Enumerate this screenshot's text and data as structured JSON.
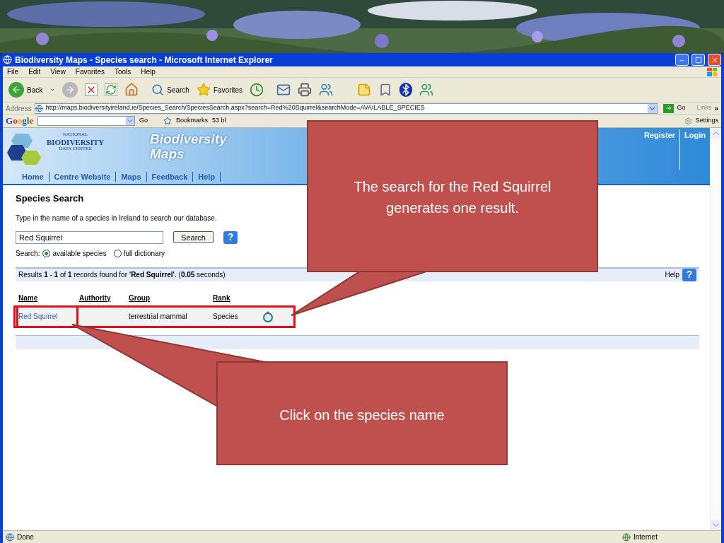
{
  "window": {
    "title": "Biodiversity Maps - Species search - Microsoft Internet Explorer"
  },
  "menu": [
    "File",
    "Edit",
    "View",
    "Favorites",
    "Tools",
    "Help"
  ],
  "toolbar": {
    "back": "Back",
    "search": "Search",
    "favorites": "Favorites"
  },
  "address": {
    "label": "Address",
    "url": "http://maps.biodiversityireland.ie/Species_Search/SpeciesSearch.aspx?search=Red%20Squirrel&searchMode=AVAILABLE_SPECIES",
    "go": "Go",
    "links": "Links",
    "more": "»"
  },
  "google_bar": {
    "logo": "Google",
    "go": "Go",
    "bookmarks": "Bookmarks",
    "blocked": "53 bl",
    "settings": "Settings"
  },
  "site": {
    "logo_lines": [
      "NATIONAL",
      "BIODIVERSITY",
      "DATA CENTRE"
    ],
    "title_lines": [
      "Biodiversity",
      "Maps"
    ],
    "nav": [
      "Home",
      "Centre Website",
      "Maps",
      "Feedback",
      "Help"
    ],
    "account": [
      "Register",
      "Login"
    ]
  },
  "search": {
    "heading": "Species Search",
    "intro": "Type in the name of a species in Ireland to search our database.",
    "value": "Red Squirrel",
    "button": "Search",
    "help_icon": "?",
    "scope_label": "Search:",
    "scopes": [
      {
        "label": "available species",
        "selected": true
      },
      {
        "label": "full dictionary",
        "selected": false
      }
    ]
  },
  "results": {
    "summary": "Results **1** - **1** of **1** records found for **'Red Squirrel'**. (**0.05** seconds)",
    "help": "Help",
    "help_icon": "?",
    "columns": [
      "Name",
      "Authority",
      "Group",
      "Rank"
    ],
    "rows": [
      {
        "name": "Red Squirrel",
        "group": "terrestrial mammal",
        "rank": "Species",
        "highlighted": true
      }
    ]
  },
  "status_bar": {
    "text": "Done",
    "zone": "Internet"
  },
  "callouts": [
    {
      "text": "The search for the Red Squirrel generates one result."
    },
    {
      "text": "Click on the species name"
    }
  ]
}
